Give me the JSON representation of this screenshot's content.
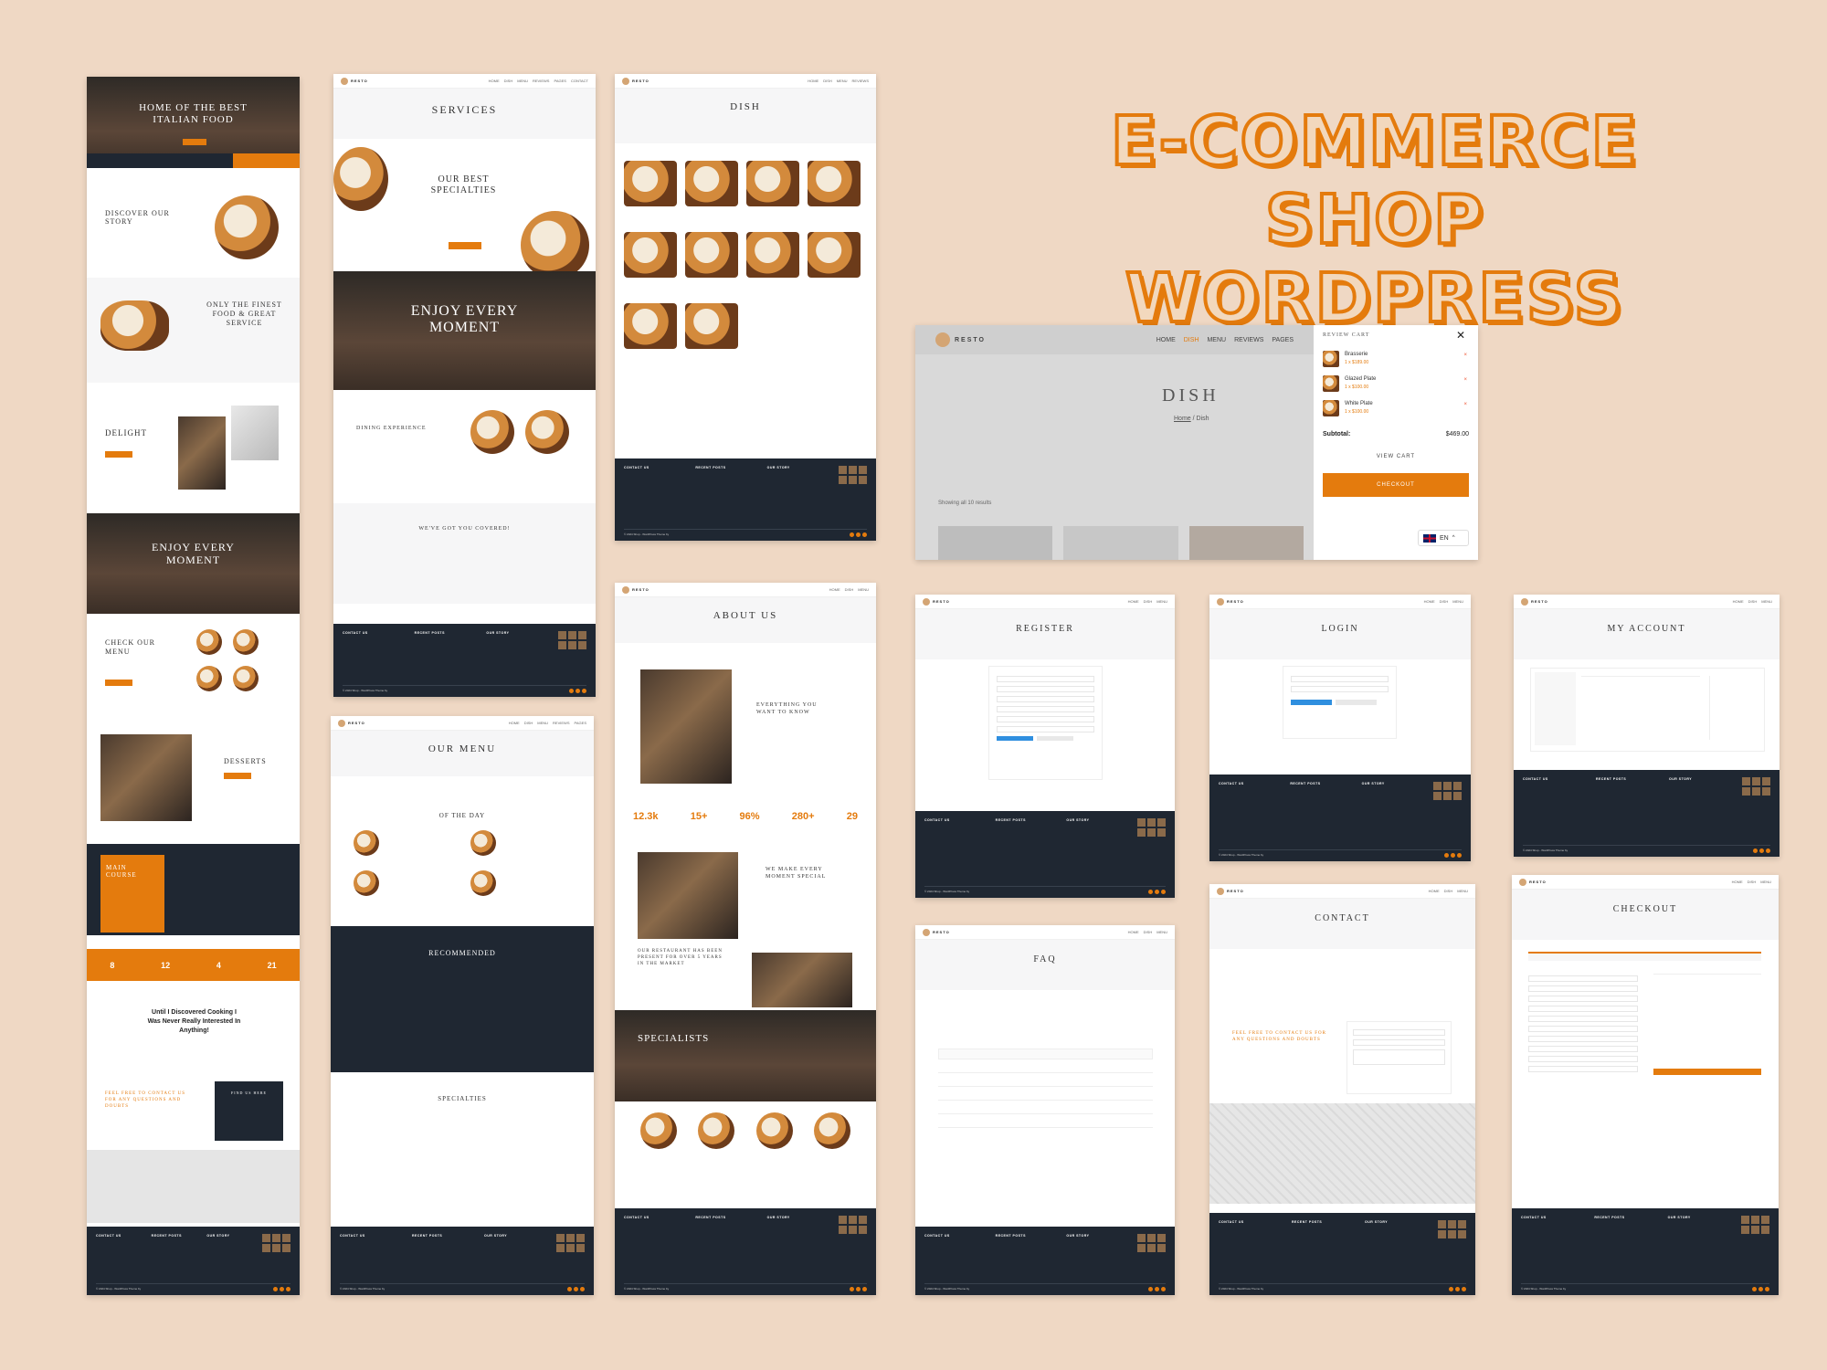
{
  "headline": {
    "line1": "E-COMMERCE SHOP",
    "line2": "WORDPRESS"
  },
  "brand": {
    "name": "RESTO",
    "accent": "#e47b0d",
    "dark": "#1f2732"
  },
  "nav": [
    "HOME",
    "DISH",
    "MENU",
    "REVIEWS",
    "PAGES",
    "CONTACT",
    "ACCOUNT"
  ],
  "footer": {
    "contact": "CONTACT US",
    "posts": "RECENT POSTS",
    "story": "OUR STORY",
    "copyright": "© 2024 Shop - WordPress Theme by"
  },
  "home": {
    "hero": "HOME OF THE BEST ITALIAN FOOD",
    "story": "DISCOVER OUR STORY",
    "finest": "ONLY THE FINEST FOOD & GREAT SERVICE",
    "delight": "DELIGHT",
    "enjoy": "ENJOY EVERY MOMENT",
    "menu": "CHECK OUR MENU",
    "desserts": "DESSERTS",
    "main_course": "MAIN COURSE",
    "stats": [
      "8",
      "12",
      "4",
      "21"
    ],
    "quote": "Until I Discovered Cooking I Was Never Really Interested In Anything!",
    "contact_head": "FEEL FREE TO CONTACT US FOR ANY QUESTIONS AND DOUBTS",
    "find": "FIND US HERE"
  },
  "services": {
    "title": "SERVICES",
    "specialties": "OUR BEST SPECIALTIES",
    "enjoy": "ENJOY EVERY MOMENT",
    "dining": "DINING EXPERIENCE",
    "covered": "WE'VE GOT YOU COVERED!"
  },
  "dish": {
    "title": "DISH"
  },
  "cart_modal": {
    "title": "DISH",
    "breadcrumb_home": "Home",
    "breadcrumb_current": "/ Dish",
    "drawer_title": "REVIEW CART",
    "items": [
      {
        "name": "Brasserie",
        "price": "1 x $189.00"
      },
      {
        "name": "Glazed Plate",
        "price": "1 x $100.00"
      },
      {
        "name": "White Plate",
        "price": "1 x $100.00"
      }
    ],
    "subtotal_label": "Subtotal:",
    "subtotal_value": "$469.00",
    "view_cart": "VIEW CART",
    "checkout": "CHECKOUT",
    "showing": "Showing all 10 results",
    "lang": "EN"
  },
  "our_menu": {
    "title": "OUR MENU",
    "day": "OF THE DAY",
    "recommended": "RECOMMENDED",
    "specialties": "SPECIALTIES"
  },
  "about": {
    "title": "ABOUT US",
    "want": "EVERYTHING YOU WANT TO KNOW",
    "stats": [
      "12.3k",
      "15+",
      "96%",
      "280+",
      "29"
    ],
    "special": "WE MAKE EVERY MOMENT SPECIAL",
    "present": "OUR RESTAURANT HAS BEEN PRESENT FOR OVER 5 YEARS IN THE MARKET",
    "specialists": "SPECIALISTS"
  },
  "register": {
    "title": "REGISTER"
  },
  "login": {
    "title": "LOGIN"
  },
  "account": {
    "title": "MY ACCOUNT"
  },
  "faq": {
    "title": "FAQ"
  },
  "contact": {
    "title": "CONTACT",
    "head": "FEEL FREE TO CONTACT US FOR ANY QUESTIONS AND DOUBTS"
  },
  "checkout": {
    "title": "CHECKOUT"
  }
}
